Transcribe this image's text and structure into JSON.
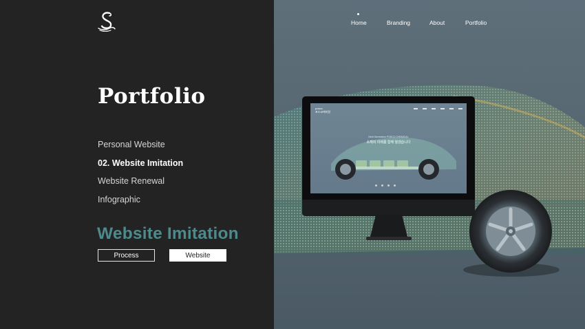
{
  "brand": {
    "logo_icon": "swan-s-logo-icon"
  },
  "nav": [
    {
      "label": "Home",
      "active": true
    },
    {
      "label": "Branding"
    },
    {
      "label": "About"
    },
    {
      "label": "Portfolio"
    }
  ],
  "page": {
    "title": "Portfolio"
  },
  "menu": [
    {
      "label": "Personal Website"
    },
    {
      "label": "02. Website Imitation",
      "active": true
    },
    {
      "label": "Website Renewal"
    },
    {
      "label": "Infographic"
    }
  ],
  "section": {
    "title": "Website Imitation"
  },
  "buttons": {
    "process": "Process",
    "website": "Website"
  },
  "preview": {
    "logo_line1": "posco",
    "logo_line2": "포스코케미칼",
    "tagline": "Next Generation POSCO CHEMICAL",
    "headline": "소재의 미래를 함께 열겠습니다"
  },
  "colors": {
    "left_bg": "#232323",
    "right_bg": "#5f6f7a",
    "accent": "#4e8a8c"
  }
}
